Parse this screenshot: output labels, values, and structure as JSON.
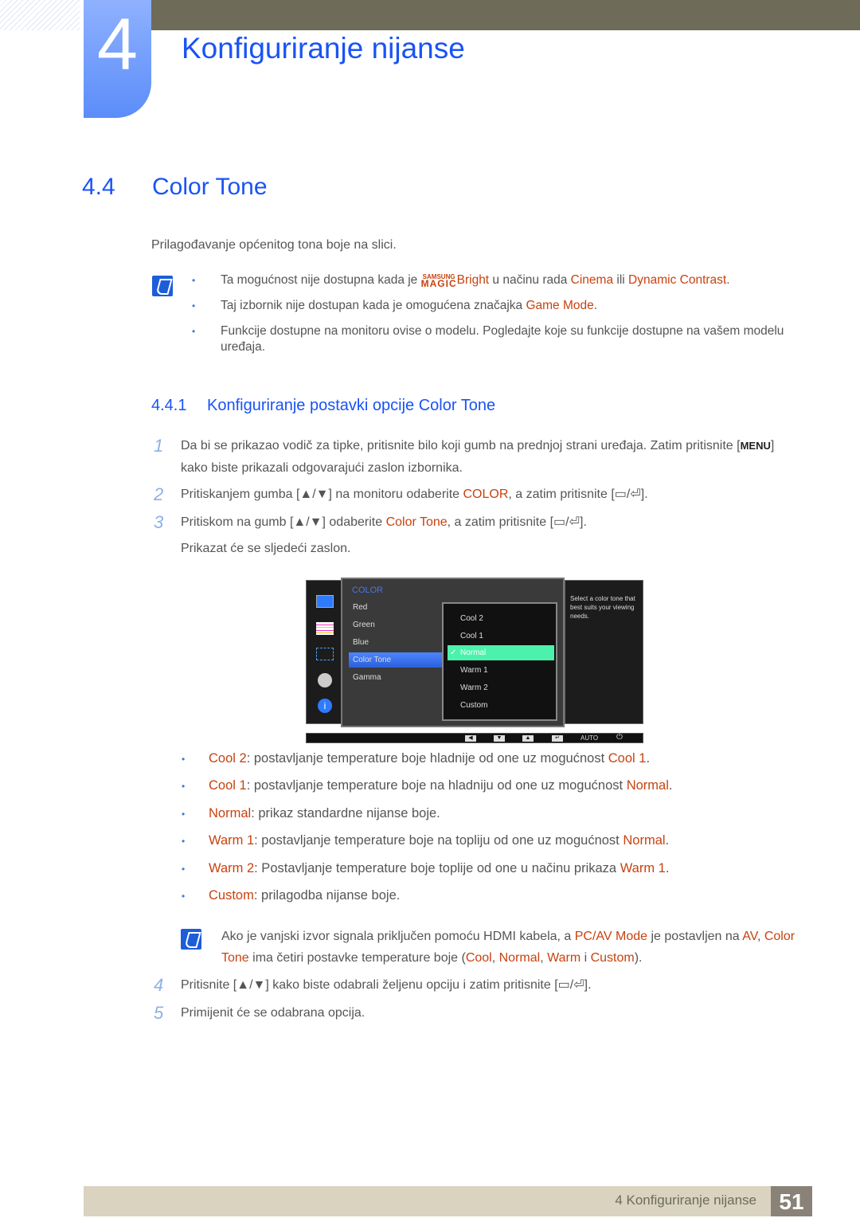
{
  "chapter": {
    "number": "4",
    "title": "Konfiguriranje nijanse"
  },
  "section": {
    "number": "4.4",
    "title": "Color Tone",
    "intro": "Prilagođavanje općenitog tona boje na slici."
  },
  "notes": [
    {
      "pre": "Ta mogućnost nije dostupna kada je ",
      "magic_top": "SAMSUNG",
      "magic_bottom": "MAGIC",
      "brand": "Bright",
      "mid": " u načinu rada ",
      "h1": "Cinema",
      "mid2": " ili ",
      "h2": "Dynamic Contrast",
      "post": "."
    },
    {
      "pre": "Taj izbornik nije dostupan kada je omogućena značajka ",
      "h1": "Game Mode",
      "post": "."
    },
    {
      "text": "Funkcije dostupne na monitoru ovise o modelu. Pogledajte koje su funkcije dostupne na vašem modelu uređaja."
    }
  ],
  "subsection": {
    "number": "4.4.1",
    "title": "Konfiguriranje postavki opcije Color Tone"
  },
  "steps": [
    {
      "n": "1",
      "a": "Da bi se prikazao vodič za tipke, pritisnite bilo koji gumb na prednjoj strani uređaja. Zatim pritisnite [",
      "key": "MENU",
      "b": "] kako biste prikazali odgovarajući zaslon izbornika."
    },
    {
      "n": "2",
      "a": "Pritiskanjem gumba [▲/▼] na monitoru odaberite ",
      "h": "COLOR",
      "b": ", a zatim pritisnite [▭/⏎]."
    },
    {
      "n": "3",
      "a": "Pritiskom na gumb [▲/▼] odaberite ",
      "h": "Color Tone",
      "b": ", a zatim pritisnite [▭/⏎].",
      "c": "Prikazat će se sljedeći zaslon."
    },
    {
      "n": "4",
      "a": "Pritisnite [▲/▼] kako biste odabrali željenu opciju i zatim pritisnite [▭/⏎]."
    },
    {
      "n": "5",
      "a": "Primijenit će se odabrana opcija."
    }
  ],
  "osd": {
    "title": "COLOR",
    "items": [
      "Red",
      "Green",
      "Blue",
      "Color Tone",
      "Gamma"
    ],
    "selected_item": "Color Tone",
    "options": [
      "Cool 2",
      "Cool 1",
      "Normal",
      "Warm 1",
      "Warm 2",
      "Custom"
    ],
    "selected_option": "Normal",
    "help": "Select a color tone that best suits your viewing needs.",
    "bar": {
      "left": "◀",
      "down": "▼",
      "up": "▲",
      "enter": "↵",
      "auto": "AUTO",
      "power": "⏻"
    }
  },
  "options_desc": [
    {
      "name": "Cool 2",
      "text": ": postavljanje temperature boje hladnije od one uz mogućnost ",
      "ref": "Cool 1",
      "end": "."
    },
    {
      "name": "Cool 1",
      "text": ": postavljanje temperature boje na hladniju od one uz mogućnost ",
      "ref": "Normal",
      "end": "."
    },
    {
      "name": "Normal",
      "text": ": prikaz standardne nijanse boje.",
      "ref": "",
      "end": ""
    },
    {
      "name": "Warm 1",
      "text": ": postavljanje temperature boje na topliju od one uz mogućnost ",
      "ref": "Normal",
      "end": "."
    },
    {
      "name": "Warm 2",
      "text": ": Postavljanje temperature boje toplije od one u načinu prikaza ",
      "ref": "Warm 1",
      "end": "."
    },
    {
      "name": "Custom",
      "text": ": prilagodba nijanse boje.",
      "ref": "",
      "end": ""
    }
  ],
  "note2": {
    "a": "Ako je vanjski izvor signala priključen pomoću HDMI kabela, a ",
    "h1": "PC/AV Mode",
    "b": " je postavljen na ",
    "h2": "AV",
    "c": ", ",
    "h3": "Color Tone",
    "d": " ima četiri postavke temperature boje (",
    "h4": "Cool",
    "e": ", ",
    "h5": "Normal",
    "f": ", ",
    "h6": "Warm",
    "g": " i ",
    "h7": "Custom",
    "h": ")."
  },
  "footer": {
    "text": "4 Konfiguriranje nijanse",
    "page": "51"
  }
}
